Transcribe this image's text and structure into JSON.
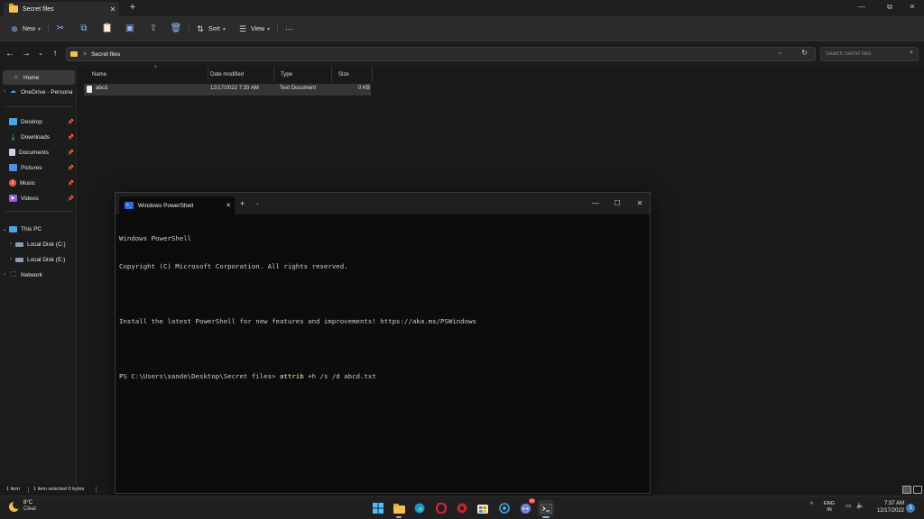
{
  "explorer": {
    "tab_title": "Secret files",
    "new_tab": "+",
    "window_controls": {
      "minimize": "—",
      "maximize": "⧉",
      "close": "✕"
    },
    "commands": {
      "new": "New",
      "sort": "Sort",
      "view": "View",
      "more": "···"
    },
    "address": {
      "separator": ">",
      "path": "Secret files"
    },
    "search": {
      "placeholder": "Search Secret files"
    },
    "sidebar": {
      "home": "Home",
      "onedrive": "OneDrive - Persona",
      "quick": [
        {
          "label": "Desktop",
          "icon": "desktop-icon",
          "color": "#4ea3e0"
        },
        {
          "label": "Downloads",
          "icon": "download-icon",
          "color": "#47c38d"
        },
        {
          "label": "Documents",
          "icon": "document-icon",
          "color": "#c9d3e0"
        },
        {
          "label": "Pictures",
          "icon": "picture-icon",
          "color": "#4b8fe0"
        },
        {
          "label": "Music",
          "icon": "music-icon",
          "color": "#e25c4a"
        },
        {
          "label": "Videos",
          "icon": "video-icon",
          "color": "#9a5be0"
        }
      ],
      "this_pc": "This PC",
      "drives": [
        "Local Disk (C:)",
        "Local Disk (E:)"
      ],
      "network": "Network"
    },
    "columns": {
      "name": "Name",
      "date": "Date modified",
      "type": "Type",
      "size": "Size"
    },
    "files": [
      {
        "name": "abcd",
        "date": "12/17/2022 7:33 AM",
        "type": "Text Document",
        "size": "0 KB"
      }
    ],
    "status": {
      "count": "1 item",
      "selected": "1 item selected  0 bytes"
    }
  },
  "terminal": {
    "tab_title": "Windows PowerShell",
    "lines": [
      "Windows PowerShell",
      "Copyright (C) Microsoft Corporation. All rights reserved.",
      "",
      "Install the latest PowerShell for new features and improvements! https://aka.ms/PSWindows",
      ""
    ],
    "prompt": "PS C:\\Users\\sande\\Desktop\\Secret files> ",
    "command": "attrib",
    "args": " +h /s /d abcd.txt"
  },
  "taskbar": {
    "weather_temp": "8°C",
    "weather_cond": "Clear",
    "lang_top": "ENG",
    "lang_bottom": "IN",
    "time": "7:37 AM",
    "date": "12/17/2022",
    "notification_count": "3",
    "discord_badge": "45"
  }
}
